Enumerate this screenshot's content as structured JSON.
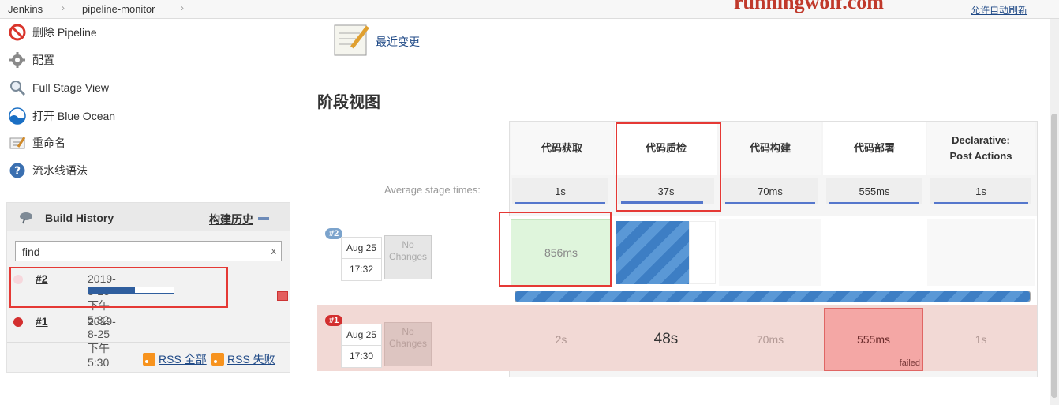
{
  "breadcrumb": {
    "home": "Jenkins",
    "job": "pipeline-monitor"
  },
  "watermark": "runningwolf.com",
  "auto_refresh": "允许自动刷新",
  "tasks": [
    {
      "label": "删除 Pipeline",
      "icon": "no-entry-icon"
    },
    {
      "label": "配置",
      "icon": "gear-icon"
    },
    {
      "label": "Full Stage View",
      "icon": "magnifier-icon"
    },
    {
      "label": "打开 Blue Ocean",
      "icon": "blue-ocean-icon"
    },
    {
      "label": "重命名",
      "icon": "rename-icon"
    },
    {
      "label": "流水线语法",
      "icon": "help-icon"
    }
  ],
  "build_history": {
    "title": "Build History",
    "trend": "构建历史",
    "search_value": "find",
    "clear": "x",
    "builds": [
      {
        "number": "#2",
        "date": "2019-8-25 下午5:32",
        "progress": 0.55,
        "status": "running"
      },
      {
        "number": "#1",
        "date": "2019-8-25 下午5:30",
        "status": "failed"
      }
    ],
    "rss_all": "RSS 全部",
    "rss_failed": "RSS 失败"
  },
  "recent_changes": "最近变更",
  "stage_view": {
    "title": "阶段视图",
    "avg_label": "Average stage times:",
    "stages": [
      "代码获取",
      "代码质检",
      "代码构建",
      "代码部署",
      "Declarative: Post Actions"
    ],
    "avg_times": [
      "1s",
      "37s",
      "70ms",
      "555ms",
      "1s"
    ],
    "avg_progress": [
      1.0,
      0.8,
      1.0,
      1.0,
      1.0
    ],
    "runs": [
      {
        "badge": "#2",
        "date": "Aug 25",
        "time": "17:32",
        "changes": "No Changes",
        "cells": [
          "856ms",
          "",
          "",
          "",
          ""
        ],
        "overall_progress": 1.0
      },
      {
        "badge": "#1",
        "date": "Aug 25",
        "time": "17:30",
        "changes": "No Changes",
        "cells": [
          "2s",
          "48s",
          "70ms",
          "555ms",
          "1s"
        ],
        "failed_label": "failed"
      }
    ]
  },
  "colors": {
    "success": "#d9f2d9",
    "failed_row": "#f2d9d5",
    "failed_cell": "#f4a7a5",
    "running": "#3d7ec4",
    "highlight": "#e53935"
  }
}
